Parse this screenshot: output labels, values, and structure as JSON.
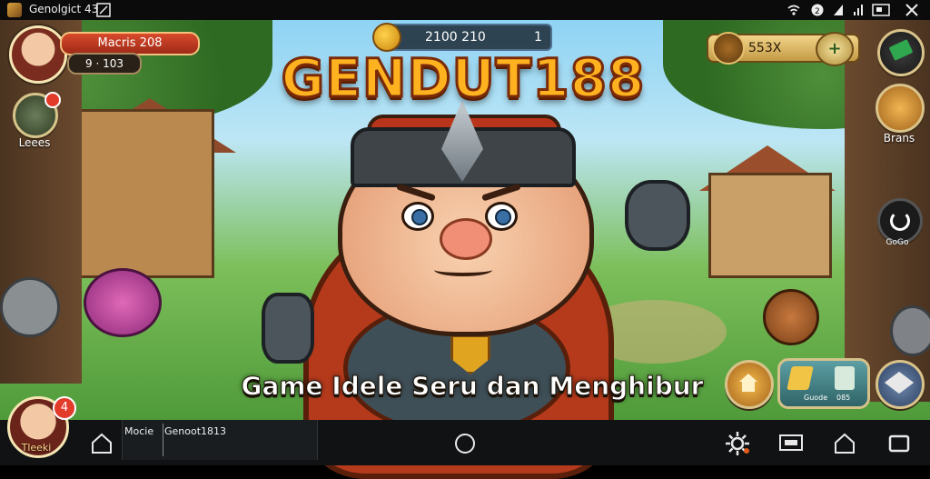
{
  "status_bar": {
    "app_title": "Genolgict 43",
    "icons": [
      "app-icon",
      "expand-icon",
      "wifi-icon",
      "data-saver-icon",
      "battery-icon",
      "signal-icon",
      "window-icon",
      "close-icon"
    ]
  },
  "game": {
    "title": "GENDUT188",
    "subtitle": "Game Idele Seru dan Menghibur",
    "player": {
      "name": "Macris 208",
      "level": "9 · 103"
    },
    "currency": {
      "value": "2100 210",
      "count": "1"
    },
    "gems": {
      "value": "553X"
    },
    "left_menu_label": "Leees",
    "right_menu_label": "Brans",
    "refresh_label": "GoGo",
    "guide_button": {
      "label_left": "Guode",
      "label_right": "085"
    },
    "profile_badge": "4",
    "profile_label": "Tleeki"
  },
  "nav_bar": {
    "tab_label_1": "Mocie",
    "tab_label_2": "Genoot1813"
  },
  "colors": {
    "title_fill": "#ffb21f",
    "title_stroke": "#7a2a08",
    "name_bar": "#d94a2b",
    "badge": "#e23b2a"
  }
}
